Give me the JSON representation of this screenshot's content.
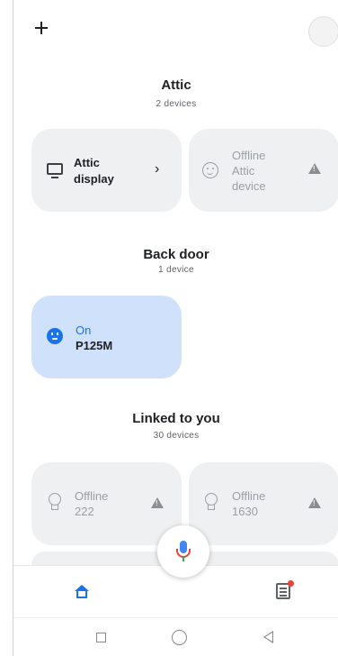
{
  "header": {
    "add_icon": "plus-icon",
    "avatar_icon": "account-avatar"
  },
  "sections": [
    {
      "title": "Attic",
      "subtitle": "2 devices",
      "devices": [
        {
          "line1": "Attic",
          "line2": "display",
          "icon": "tv-icon",
          "status": "online"
        },
        {
          "line1": "Offline",
          "line2": "Attic",
          "line3": "device",
          "icon": "smiley-icon",
          "status": "offline"
        }
      ]
    },
    {
      "title": "Back door",
      "subtitle": "1 device",
      "devices": [
        {
          "line1": "On",
          "line2": "P125M",
          "icon": "plug-icon",
          "status": "on"
        }
      ]
    },
    {
      "title": "Linked to you",
      "subtitle": "30 devices",
      "devices": [
        {
          "line1": "Offline",
          "line2": "222",
          "icon": "bulb-icon",
          "status": "offline"
        },
        {
          "line1": "Offline",
          "line2": "1630",
          "icon": "bulb-icon",
          "status": "offline"
        }
      ]
    }
  ],
  "bottom_nav": {
    "home_icon": "home-icon",
    "feed_icon": "feed-icon"
  },
  "colors": {
    "accent": "#1a73e8",
    "tile_bg": "#eef0f2",
    "tile_on_bg": "#cfe1fb"
  }
}
